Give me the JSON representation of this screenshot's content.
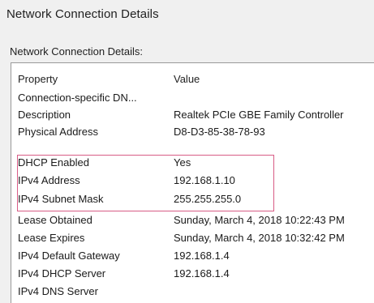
{
  "window": {
    "title": "Network Connection Details"
  },
  "section": {
    "label": "Network Connection Details:"
  },
  "table": {
    "columns": [
      "Property",
      "Value"
    ],
    "rows": [
      {
        "property": "Connection-specific DN...",
        "value": ""
      },
      {
        "property": "Description",
        "value": "Realtek PCIe GBE Family Controller"
      },
      {
        "property": "Physical Address",
        "value": "D8-D3-85-38-78-93"
      },
      {
        "property": "DHCP Enabled",
        "value": "Yes"
      },
      {
        "property": "IPv4 Address",
        "value": "192.168.1.10"
      },
      {
        "property": "IPv4 Subnet Mask",
        "value": "255.255.255.0"
      },
      {
        "property": "Lease Obtained",
        "value": "Sunday, March 4, 2018 10:22:43 PM"
      },
      {
        "property": "Lease Expires",
        "value": "Sunday, March 4, 2018 10:32:42 PM"
      },
      {
        "property": "IPv4 Default Gateway",
        "value": "192.168.1.4"
      },
      {
        "property": "IPv4 DHCP Server",
        "value": "192.168.1.4"
      },
      {
        "property": "IPv4 DNS Server",
        "value": ""
      }
    ]
  },
  "highlight": {
    "color": "#d85c86"
  }
}
